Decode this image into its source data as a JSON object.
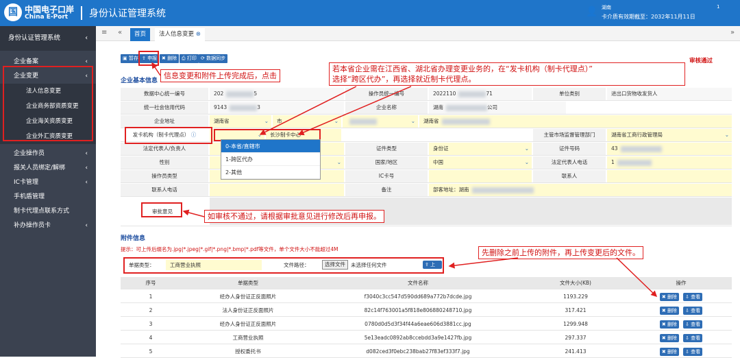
{
  "header": {
    "logo_glyph": "国",
    "logo_cn": "中国电子口岸",
    "logo_en": "China E-Port",
    "title": "身份认证管理系统",
    "user_name": "湖南",
    "user_name_suffix": "1",
    "card_expiry": "卡介质有效期截至：2032年11月11日"
  },
  "sidebar": {
    "title": "身份认证管理系统",
    "items": [
      {
        "label": "企业备案",
        "chevron": "‹"
      },
      {
        "label": "企业变更",
        "chevron": "‹"
      },
      {
        "label": "企业操作员",
        "chevron": "‹"
      },
      {
        "label": "报关人员绑定/解绑",
        "chevron": "‹"
      },
      {
        "label": "IC卡管理",
        "chevron": "‹"
      },
      {
        "label": "手机盾管理",
        "chevron": ""
      },
      {
        "label": "制卡代理点联系方式",
        "chevron": ""
      },
      {
        "label": "补办操作员卡",
        "chevron": "‹"
      }
    ],
    "subitems": [
      "法人信息变更",
      "企业商务部资质变更",
      "企业海关资质变更",
      "企业外汇资质变更"
    ]
  },
  "tabs": {
    "home": "首页",
    "active": "法人信息变更"
  },
  "toolbar": {
    "save": "暂存",
    "declare": "申报",
    "delete": "删除",
    "print": "打印",
    "sync": "数据同步"
  },
  "status": "审核通过",
  "section_basic": "企业基本信息",
  "form": {
    "r1": [
      "数据中心统一编号",
      "202",
      "5",
      "操作员统一编号",
      "2022110",
      "71",
      "单位类别",
      "进出口货物收发货人"
    ],
    "r2": [
      "统一社会信用代码",
      "9143",
      "3",
      "企业名称",
      "湖南",
      "公司"
    ],
    "r3": [
      "企业地址",
      "湖南省",
      "市",
      "湖南省"
    ],
    "r4": [
      "发卡机构（制卡代理点）",
      "长沙制卡中心",
      "主管市场监督管理部门",
      "湖南省工商行政管理局"
    ],
    "r5": [
      "法定代表人/负责人",
      "证件类型",
      "身份证",
      "证件号码",
      "43"
    ],
    "r6": [
      "性别",
      "国家/地区",
      "中国",
      "法定代表人电话",
      "1"
    ],
    "r7": [
      "操作员类型",
      "IC卡号",
      "联系人"
    ],
    "r8": [
      "联系人电话",
      "备注",
      "部客地址：湖南"
    ],
    "approval": "审批意见"
  },
  "dropdown": [
    "0-本省/直辖市",
    "1-跨区代办",
    "2-其他"
  ],
  "section_attach": "附件信息",
  "hint": "提示：可上传后缀名为.jpg|*.jpeg|*.gif|*.png|*.bmp|*.pdf等文件，单个文件大小不能超过4M",
  "upload": {
    "type_label": "单据类型：",
    "type_value": "工商营业执照",
    "path_label": "文件路径：",
    "choose": "选择文件",
    "no_file": "未选择任何文件",
    "upload_btn": "上传"
  },
  "file_table": {
    "headers": [
      "序号",
      "单据类型",
      "文件名称",
      "文件大小(KB)",
      "操作"
    ],
    "rows": [
      [
        "1",
        "经办人身份证正反面照片",
        "f3040c3cc547d590dd689a772b7dcde.jpg",
        "1193.229"
      ],
      [
        "2",
        "法人身份证正反面照片",
        "82c14f763001a5f818e806880248710.jpg",
        "317.421"
      ],
      [
        "3",
        "经办人身份证正反面照片",
        "0780d0d5d3f34f44a6eae606d3881cc.jpg",
        "1299.948"
      ],
      [
        "4",
        "工商营业执照",
        "5e13eadc0892ab8ccebdd3a9e1427fb.jpg",
        "297.337"
      ],
      [
        "5",
        "授权委托书",
        "d082ced3f0ebc238bab27f83ef333f7.jpg",
        "241.413"
      ]
    ],
    "del": "删除",
    "view": "查看"
  },
  "callouts": {
    "c1": "信息变更和附件上传完成后，点击",
    "c2a": "若本省企业需在江西省、湖北省办理变更业务的，在“发卡机构（制卡代理点）”",
    "c2b": "选择“跨区代办”，再选择就近制卡代理点。",
    "c3": "如审核不通过，请根据审批意见进行修改后再申报。",
    "c4": "先删除之前上传的附件，再上传变更后的文件。"
  }
}
